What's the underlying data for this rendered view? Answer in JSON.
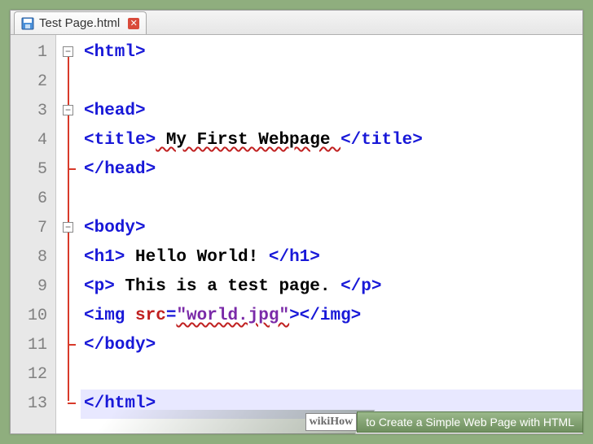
{
  "tab": {
    "filename": "Test Page.html"
  },
  "lines": [
    "1",
    "2",
    "3",
    "4",
    "5",
    "6",
    "7",
    "8",
    "9",
    "10",
    "11",
    "12",
    "13"
  ],
  "code": {
    "l1": {
      "indent": "",
      "tag": "<html>"
    },
    "l3": {
      "indent": "",
      "tag": "<head>"
    },
    "l4": {
      "indent": "",
      "open": "<title>",
      "text": " My First Webpage ",
      "close": "</title>"
    },
    "l5": {
      "indent": "",
      "tag": "</head>"
    },
    "l7": {
      "indent": "",
      "tag": "<body>"
    },
    "l8": {
      "indent": "",
      "open": "<h1>",
      "text": " Hello World! ",
      "close": "</h1>"
    },
    "l9": {
      "indent": "",
      "open": "<p>",
      "text": " This is a test page. ",
      "close": "</p>"
    },
    "l10": {
      "indent": "",
      "open": "<img ",
      "attr": "src",
      "eq": "=",
      "val": "\"world.jpg\"",
      "mid": ">",
      "close": "</img>"
    },
    "l11": {
      "indent": "",
      "tag": "</body>"
    },
    "l13": {
      "indent": "",
      "tag": "</html>"
    }
  },
  "watermark": {
    "brand": "wikiHow",
    "title": " to Create a Simple Web Page with HTML"
  }
}
